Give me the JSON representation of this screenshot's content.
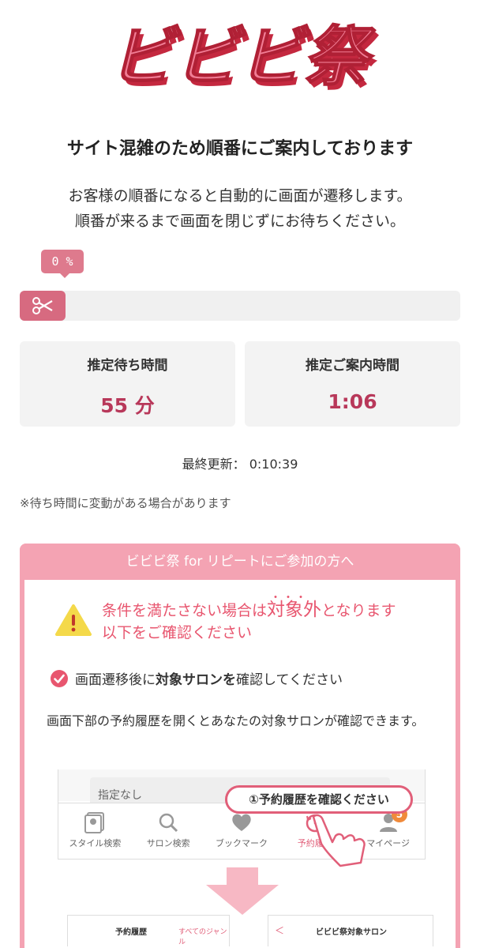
{
  "header": {
    "logo_text": "ビビビ祭"
  },
  "queue": {
    "title": "サイト混雑のため順番にご案内しております",
    "desc_line1": "お客様の順番になると自動的に画面が遷移します。",
    "desc_line2": "順番が来るまで画面を閉じずにお待ちください。",
    "progress_label": "0 %",
    "progress_value": 0,
    "wait_label": "推定待ち時間",
    "wait_value": "55 分",
    "guide_label": "推定ご案内時間",
    "guide_value": "1:06",
    "updated_label": "最終更新：",
    "updated_value": "0:10:39",
    "note": "※待ち時間に変動がある場合があります"
  },
  "repeat": {
    "header": "ビビビ祭 for リピートにご参加の方へ",
    "warn_line1_a": "条件を満たさない場合は",
    "warn_line1_big": "対象外",
    "warn_line1_b": "となります",
    "warn_line2": "以下をご確認ください",
    "check_a": "画面遷移後に",
    "check_bold": "対象サロンを",
    "check_b": "確認してください",
    "explain": "画面下部の予約履歴を開くとあなたの対象サロンが確認できます。",
    "callout": "①予約履歴を確認ください",
    "field_text": "指定なし",
    "nav": [
      "スタイル検索",
      "サロン検索",
      "ブックマーク",
      "予約履歴",
      "マイページ"
    ],
    "nav_badge": "5",
    "mini_left_title": "予約履歴",
    "mini_left_genre": "すべてのジャンル",
    "mini_right_back": "＜",
    "mini_right_title": "ビビビ祭対象サロン"
  },
  "colors": {
    "brand_pink": "#e15f79",
    "progress": "#d76a80",
    "accent_value": "#b8385a",
    "box_border": "#f4a3b3"
  }
}
